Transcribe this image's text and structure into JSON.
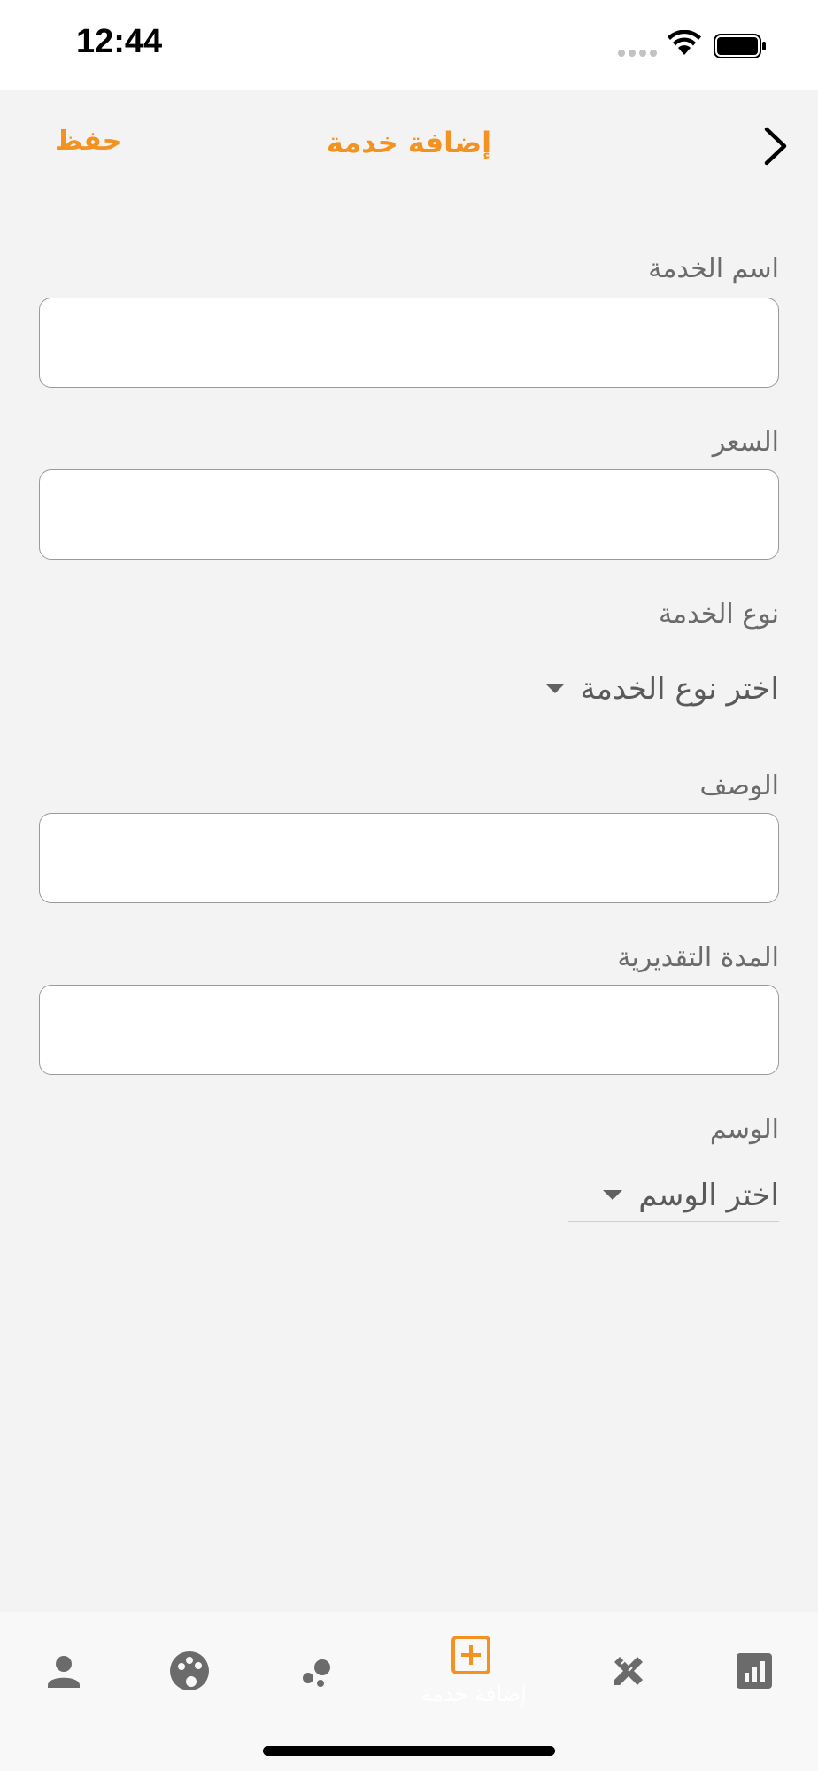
{
  "status_bar": {
    "time": "12:44"
  },
  "nav": {
    "save_label": "حفظ",
    "title": "إضافة خدمة"
  },
  "form": {
    "service_name_label": "اسم الخدمة",
    "service_name_value": "",
    "price_label": "السعر",
    "price_value": "",
    "service_type_label": "نوع الخدمة",
    "service_type_selected": "اختر نوع الخدمة",
    "description_label": "الوصف",
    "description_value": "",
    "duration_label": "المدة التقديرية",
    "duration_value": "",
    "tag_label": "الوسم",
    "tag_selected": "اختر الوسم"
  },
  "tab_bar": {
    "active_label": "إضافة خدمة",
    "icons": [
      "person-icon",
      "palette-icon",
      "bubbles-icon",
      "add-box-icon",
      "design-tools-icon",
      "chart-icon"
    ]
  },
  "colors": {
    "accent": "#f39221",
    "background": "#f3f3f3",
    "icon_gray": "#6b6b6b"
  }
}
